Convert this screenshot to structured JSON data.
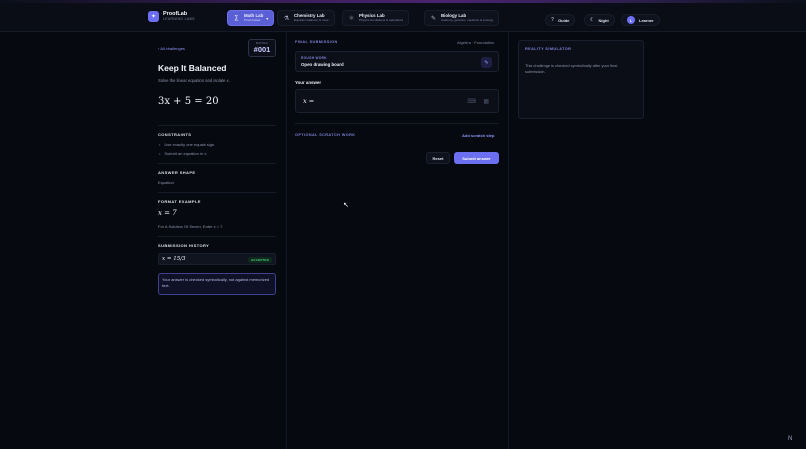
{
  "brand": {
    "name": "ProofLab",
    "sub": "LEARNING LABS",
    "logo_icon": "spark-icon"
  },
  "nav": {
    "tabs": [
      {
        "title": "Math Lab",
        "sub": "Proof-based",
        "icon": "sigma-icon",
        "active": true
      },
      {
        "title": "Chemistry Lab",
        "sub": "Equation balancer & more",
        "icon": "flask-icon"
      },
      {
        "title": "Physics Lab",
        "sub": "Physics simulations & calculators",
        "icon": "atom-icon"
      },
      {
        "title": "Biology Lab",
        "sub": "Anatomy, genetics, medicine & ecology",
        "icon": "dna-icon"
      }
    ],
    "guide": "Guide",
    "theme": "Night",
    "user": "Learner",
    "avatar_initial": "L"
  },
  "challenge": {
    "back": "All challenges",
    "rating_label": "RATING",
    "rating_value": "#001",
    "title": "Keep It Balanced",
    "description": "Solve the linear equation and isolate x.",
    "equation": "3x + 5 = 20",
    "constraints_head": "CONSTRAINTS",
    "constraints": [
      "Use exactly one equals sign.",
      "Submit an equation in x."
    ],
    "answer_shape_head": "ANSWER SHAPE",
    "answer_shape": "Equation",
    "format_head": "FORMAT EXAMPLE",
    "format_math": "x = 7",
    "format_text": "For A Solution Of Seven, Enter  x = 7.",
    "history_head": "SUBMISSION HISTORY",
    "history": [
      {
        "math": "x = 15/3",
        "status": "ACCEPTED"
      }
    ],
    "note": "Your answer is checked symbolically, not against memorized text."
  },
  "submission": {
    "head": "FINAL SUBMISSION",
    "topic": "Algebra · Foundation",
    "rough_label": "ROUGH WORK",
    "rough_action": "Open drawing board",
    "answer_label": "Your answer",
    "answer_value": "x =",
    "scratch_head": "OPTIONAL SCRATCH WORK",
    "scratch_add": "Add scratch step",
    "reset": "Reset",
    "submit": "Submit answer"
  },
  "simulator": {
    "head": "REALITY SIMULATOR",
    "text": "This challenge is checked symbolically after your final submission."
  },
  "colors": {
    "accent": "#6b6ff0",
    "accepted": "#4fd38a",
    "background": "#060910"
  }
}
